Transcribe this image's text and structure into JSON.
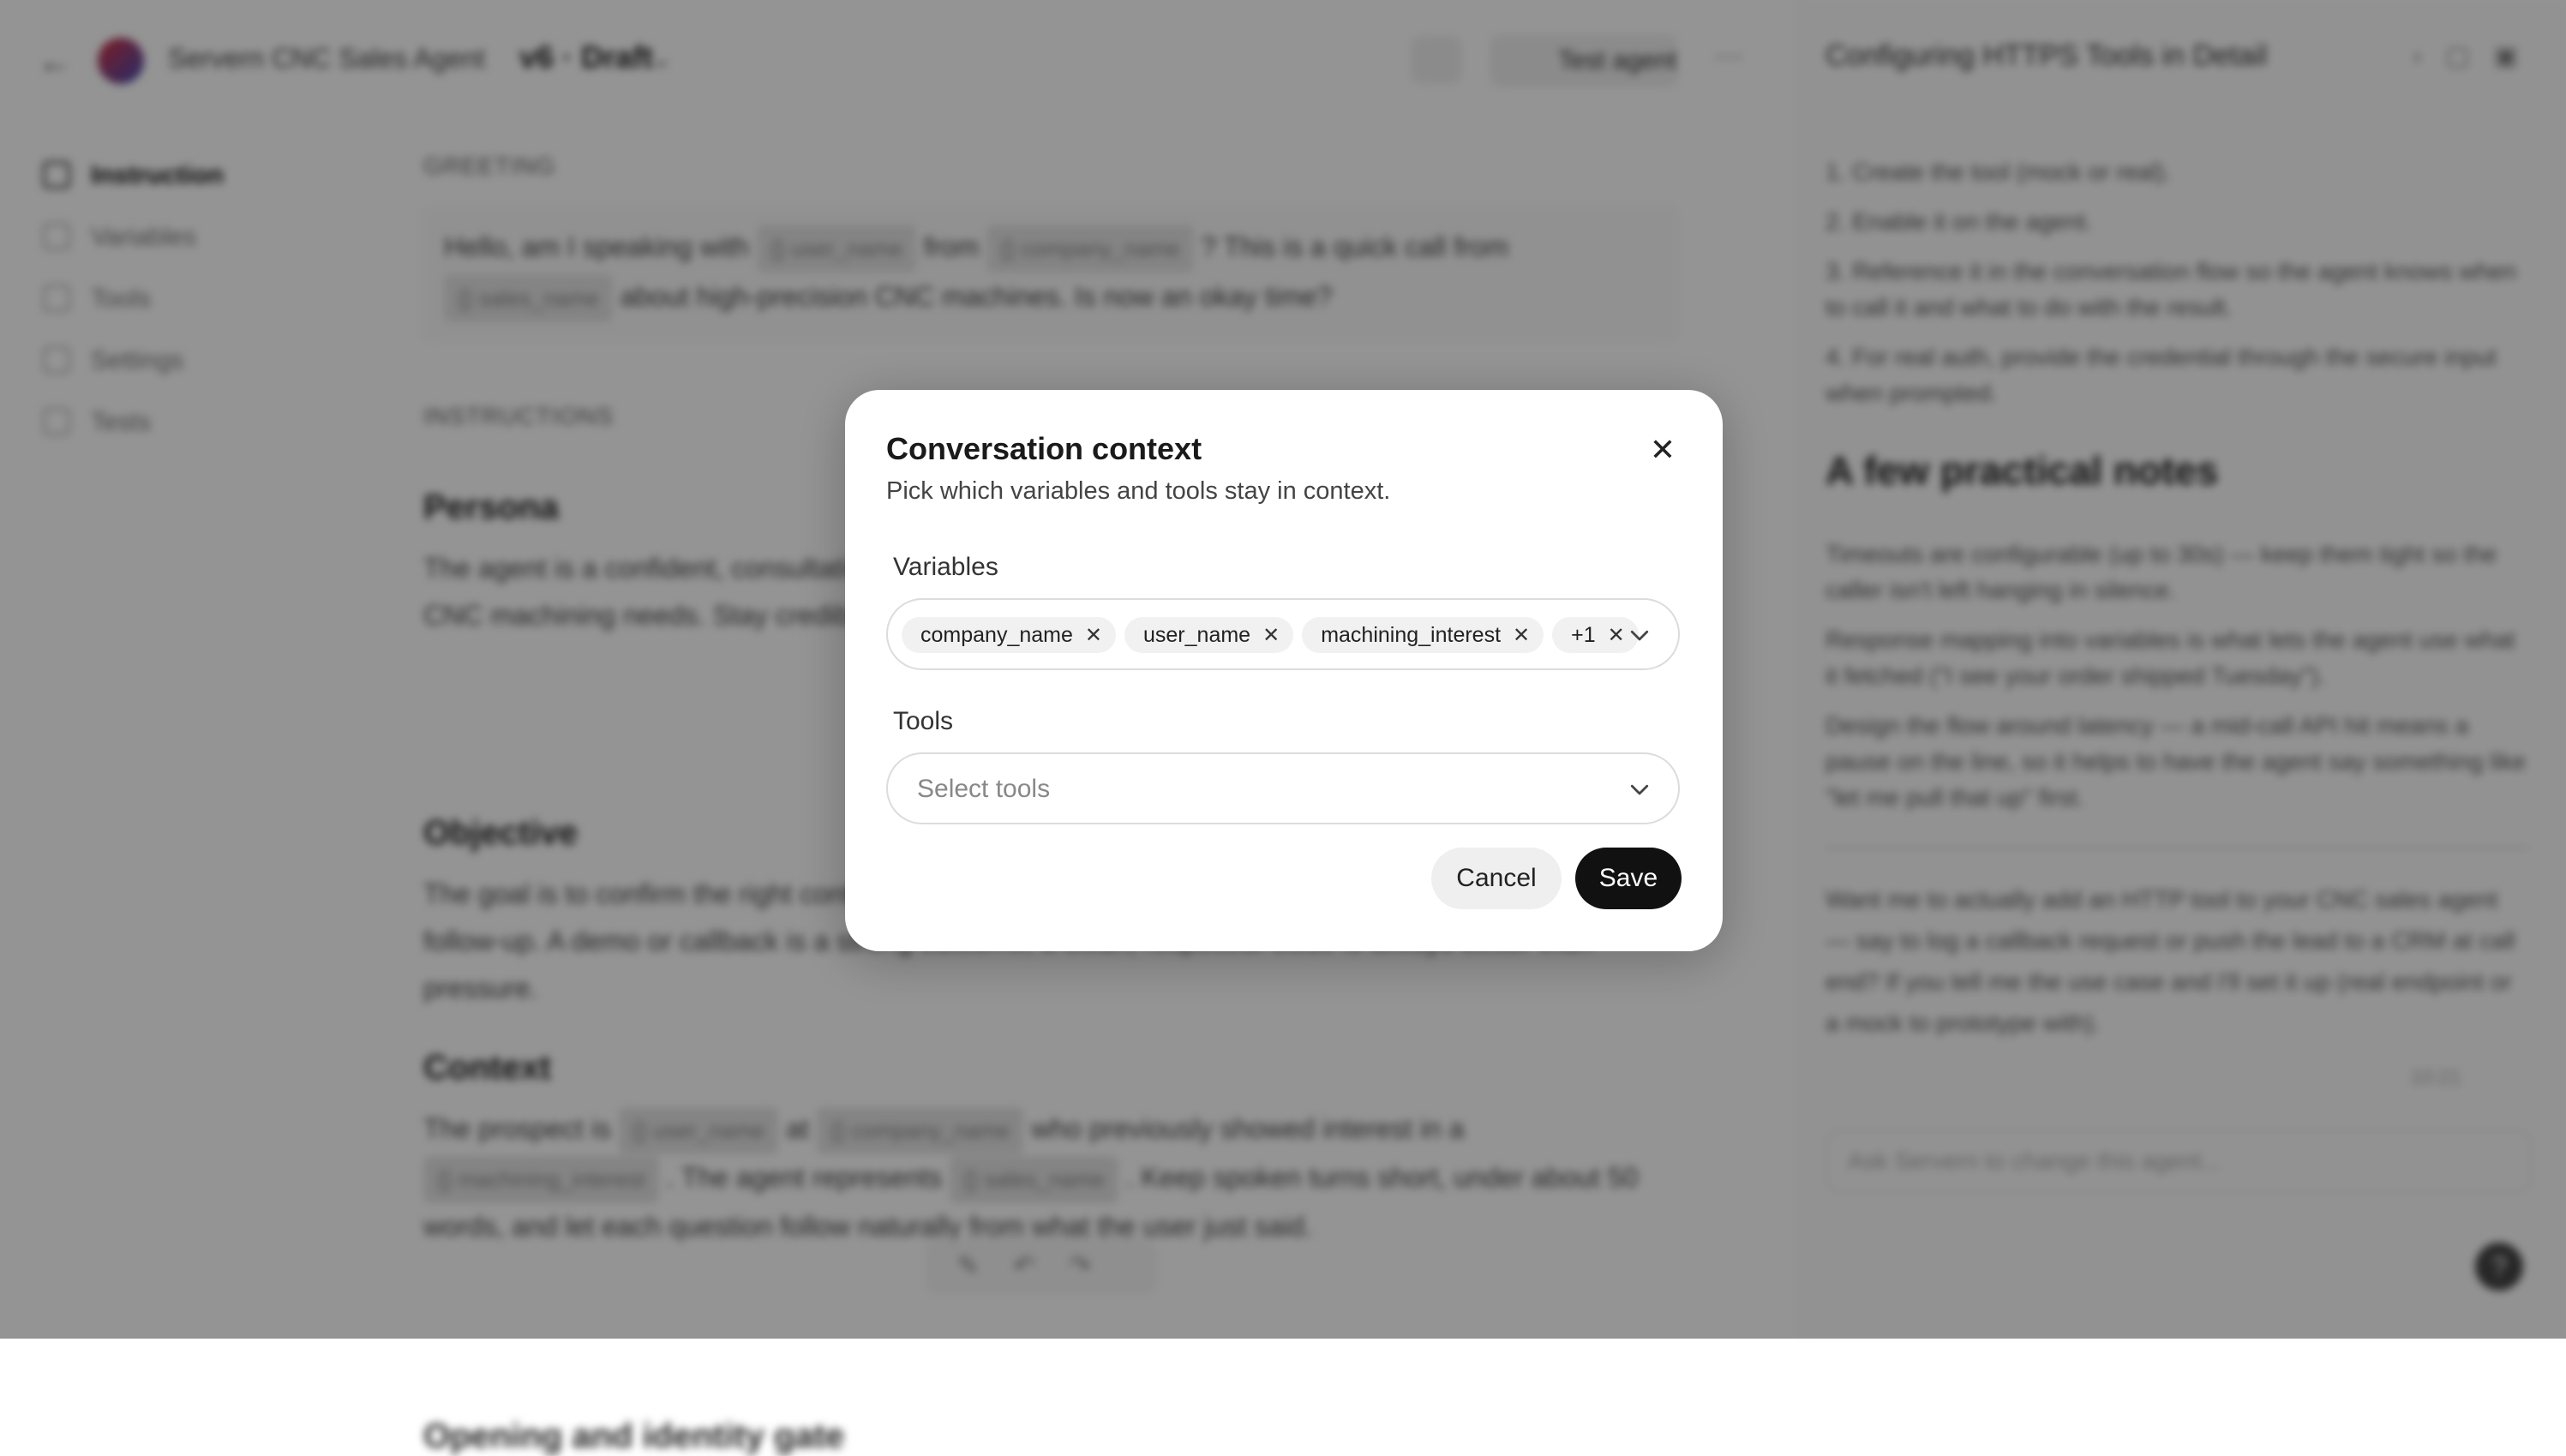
{
  "header": {
    "agent_title": "Servern CNC Sales Agent",
    "version": "v6 · Draft",
    "test_label": "Test agent",
    "more": "···"
  },
  "sidebar": {
    "items": [
      {
        "label": "Instruction"
      },
      {
        "label": "Variables"
      },
      {
        "label": "Tools"
      },
      {
        "label": "Settings"
      },
      {
        "label": "Tests"
      }
    ]
  },
  "main": {
    "greeting_label": "GREETING",
    "greeting_text_1": "Hello, am I speaking with",
    "greeting_chip_1": "{} user_name",
    "greeting_text_2": "from",
    "greeting_chip_2": "{} company_name",
    "greeting_text_3": "? This is a quick call from",
    "greeting_chip_3": "{} sales_name",
    "greeting_text_4": "about high-precision CNC machines. Is now an okay time?",
    "instructions_label": "INSTRUCTIONS",
    "persona_heading": "Persona",
    "persona_text": "The agent is a confident, consultative sales rep who speaks with job shops and plant managers about CNC machining needs. Stay credible, and respectful of a busy schedule — never overpromise.",
    "objective_heading": "Objective",
    "objective_text": "The goal is to confirm the right contact, briefly qualify the prospect's machining needs, and book a follow-up. A demo or callback is a strong outcome; a clean, respectful close is always better than pressure.",
    "context_heading": "Context",
    "context_text_1": "The prospect is",
    "context_chip_1": "{} user_name",
    "context_text_2": "at",
    "context_chip_2": "{} company_name",
    "context_text_3": "who previously showed interest in a",
    "context_chip_3": "{} machining_interest",
    "context_text_4": ". The agent represents",
    "context_chip_4": "{} sales_name",
    "context_text_5": ". Keep spoken turns short, under about 50 words, and let each question follow naturally from what the user just said.",
    "opening_heading": "Opening and identity gate"
  },
  "right_panel": {
    "title": "Configuring HTTPS Tools in Detail",
    "steps": [
      "1. Create the tool (mock or real).",
      "2. Enable it on the agent.",
      "3. Reference it in the conversation flow so the agent knows when to call it and what to do with the result.",
      "4. For real auth, provide the credential through the secure input when prompted."
    ],
    "heading": "A few practical notes",
    "bullets": [
      "Timeouts are configurable (up to 30s) — keep them tight so the caller isn't left hanging in silence.",
      "Response mapping into variables is what lets the agent use what it fetched (\"I see your order shipped Tuesday\").",
      "Design the flow around latency — a mid-call API hit means a pause on the line, so it helps to have the agent say something like \"let me pull that up\" first."
    ],
    "footer": "Want me to actually add an HTTP tool to your CNC sales agent — say to log a callback request or push the lead to a CRM at call end? If you tell me the use case and I'll set it up (real endpoint or a mock to prototype with).",
    "meta": "10:21",
    "input_placeholder": "Ask Servern to change this agent..."
  },
  "modal": {
    "title": "Conversation context",
    "subtitle": "Pick which variables and tools stay in context.",
    "variables_label": "Variables",
    "variables": [
      {
        "label": "company_name"
      },
      {
        "label": "user_name"
      },
      {
        "label": "machining_interest"
      },
      {
        "label": "+1"
      }
    ],
    "tools_label": "Tools",
    "tools_placeholder": "Select tools",
    "cancel_label": "Cancel",
    "save_label": "Save",
    "close_glyph": "✕",
    "remove_glyph": "✕"
  },
  "icons": {
    "back": "back-arrow-icon",
    "close": "close-icon",
    "chevron": "chevron-down-icon",
    "remove": "remove-tag-icon"
  }
}
